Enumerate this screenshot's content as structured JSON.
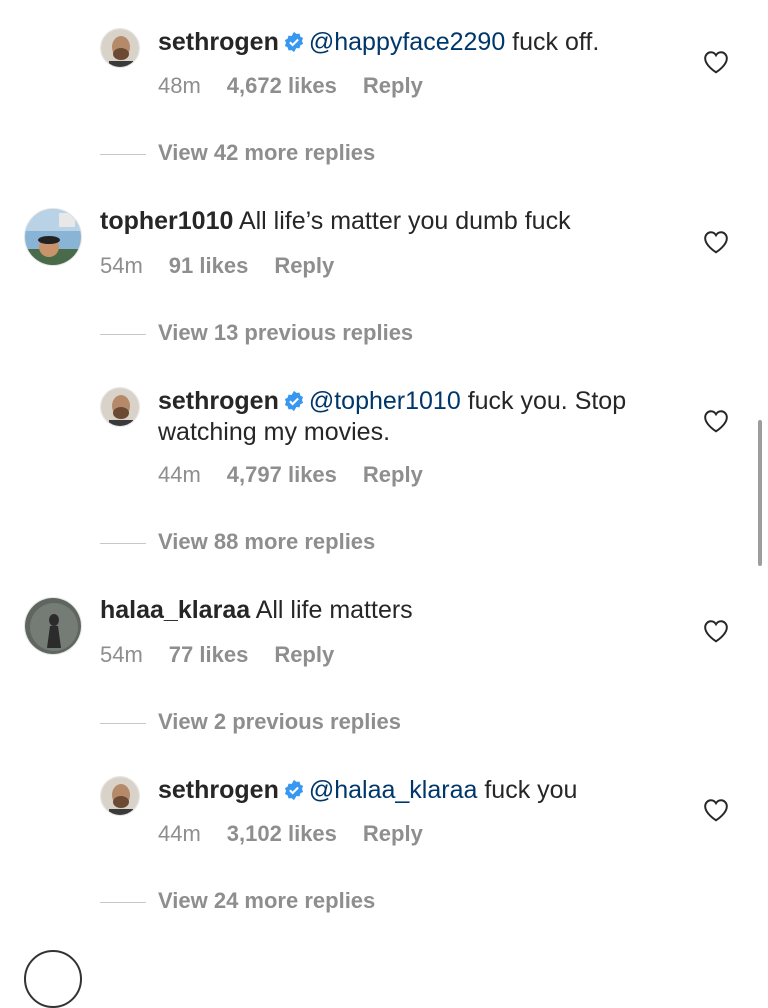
{
  "comments": [
    {
      "user": "sethrogen",
      "verified": true,
      "mention": "@happyface2290",
      "text": " fuck off.",
      "meta": {
        "time": "48m",
        "likes": "4,672 likes",
        "reply": "Reply"
      }
    },
    {
      "view_more": "View 42 more replies"
    },
    {
      "user": "topher1010",
      "text": " All life’s matter you dumb fuck",
      "meta": {
        "time": "54m",
        "likes": "91 likes",
        "reply": "Reply"
      }
    },
    {
      "view_more": "View 13 previous replies"
    },
    {
      "user": "sethrogen",
      "verified": true,
      "mention": "@topher1010",
      "text": " fuck you. Stop",
      "text_line2": "watching my movies.",
      "meta": {
        "time": "44m",
        "likes": "4,797 likes",
        "reply": "Reply"
      }
    },
    {
      "view_more": "View 88 more replies"
    },
    {
      "user": "halaa_klaraa",
      "text": " All life matters",
      "meta": {
        "time": "54m",
        "likes": "77 likes",
        "reply": "Reply"
      }
    },
    {
      "view_more": "View 2 previous replies"
    },
    {
      "user": "sethrogen",
      "verified": true,
      "mention": "@halaa_klaraa",
      "text": " fuck you",
      "meta": {
        "time": "44m",
        "likes": "3,102 likes",
        "reply": "Reply"
      }
    },
    {
      "view_more": "View 24 more replies"
    }
  ],
  "colors": {
    "text": "#262626",
    "meta": "#8e8e8e",
    "mention": "#00376b",
    "verified": "#3897f0"
  },
  "icons": {
    "like": "heart-outline-icon",
    "verified": "verified-badge-icon"
  }
}
